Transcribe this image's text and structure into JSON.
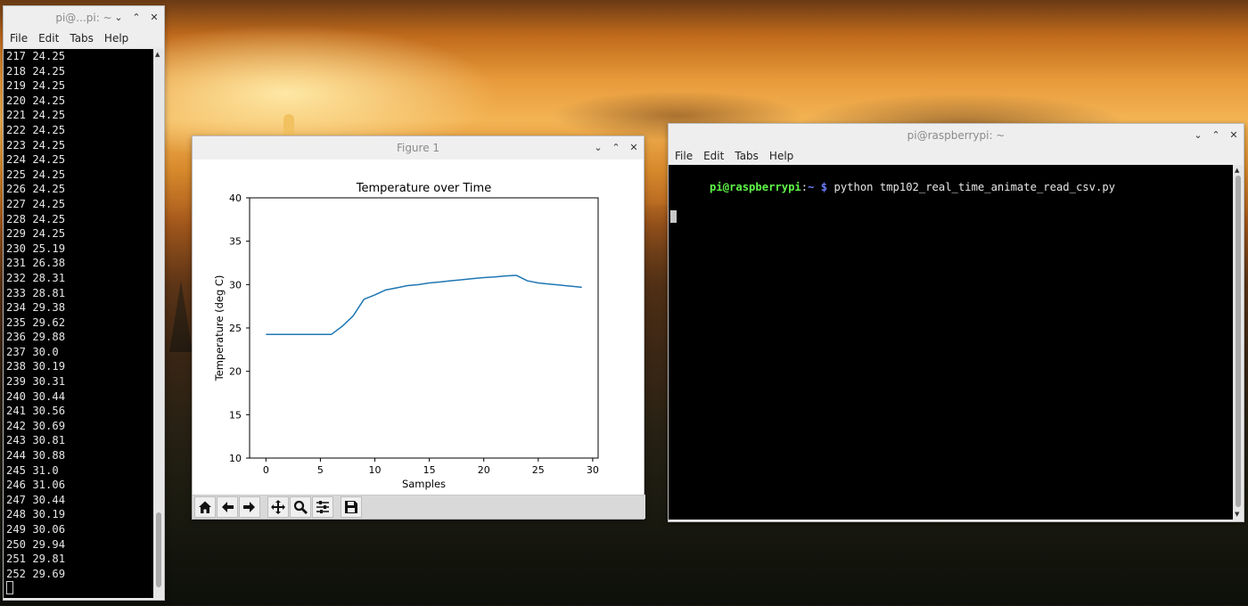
{
  "left_terminal": {
    "title": "pi@...pi: ~",
    "menu": [
      "File",
      "Edit",
      "Tabs",
      "Help"
    ],
    "lines": [
      "217 24.25",
      "218 24.25",
      "219 24.25",
      "220 24.25",
      "221 24.25",
      "222 24.25",
      "223 24.25",
      "224 24.25",
      "225 24.25",
      "226 24.25",
      "227 24.25",
      "228 24.25",
      "229 24.25",
      "230 25.19",
      "231 26.38",
      "232 28.31",
      "233 28.81",
      "234 29.38",
      "235 29.62",
      "236 29.88",
      "237 30.0",
      "238 30.19",
      "239 30.31",
      "240 30.44",
      "241 30.56",
      "242 30.69",
      "243 30.81",
      "244 30.88",
      "245 31.0",
      "246 31.06",
      "247 30.44",
      "248 30.19",
      "249 30.06",
      "250 29.94",
      "251 29.81",
      "252 29.69"
    ]
  },
  "figure": {
    "title": "Figure 1",
    "toolbar_icons": [
      "home-icon",
      "back-arrow-icon",
      "forward-arrow-icon",
      "pan-icon",
      "zoom-icon",
      "configure-subplots-icon",
      "save-icon"
    ]
  },
  "chart_data": {
    "type": "line",
    "title": "Temperature over Time",
    "xlabel": "Samples",
    "ylabel": "Temperature (deg C)",
    "xlim": [
      -1.5,
      30.5
    ],
    "ylim": [
      10,
      40
    ],
    "xticks": [
      0,
      5,
      10,
      15,
      20,
      25,
      30
    ],
    "yticks": [
      10,
      15,
      20,
      25,
      30,
      35,
      40
    ],
    "grid": false,
    "series": [
      {
        "color": "#1f77b4",
        "x": [
          0,
          1,
          2,
          3,
          4,
          5,
          6,
          7,
          8,
          9,
          10,
          11,
          12,
          13,
          14,
          15,
          16,
          17,
          18,
          19,
          20,
          21,
          22,
          23,
          24,
          25,
          26,
          27,
          28,
          29
        ],
        "y": [
          24.25,
          24.25,
          24.25,
          24.25,
          24.25,
          24.25,
          24.25,
          25.19,
          26.38,
          28.31,
          28.81,
          29.38,
          29.62,
          29.88,
          30.0,
          30.19,
          30.31,
          30.44,
          30.56,
          30.69,
          30.81,
          30.88,
          31.0,
          31.06,
          30.44,
          30.19,
          30.06,
          29.94,
          29.81,
          29.69
        ]
      }
    ]
  },
  "right_terminal": {
    "title": "pi@raspberrypi: ~",
    "menu": [
      "File",
      "Edit",
      "Tabs",
      "Help"
    ],
    "prompt_user": "pi@raspberrypi",
    "prompt_sep": ":",
    "prompt_path": "~",
    "prompt_symbol": "$",
    "command": "python tmp102_real_time_animate_read_csv.py"
  },
  "colors": {
    "prompt_user": "#5ff548",
    "prompt_path": "#6b7cff",
    "line": "#1f77b4"
  }
}
